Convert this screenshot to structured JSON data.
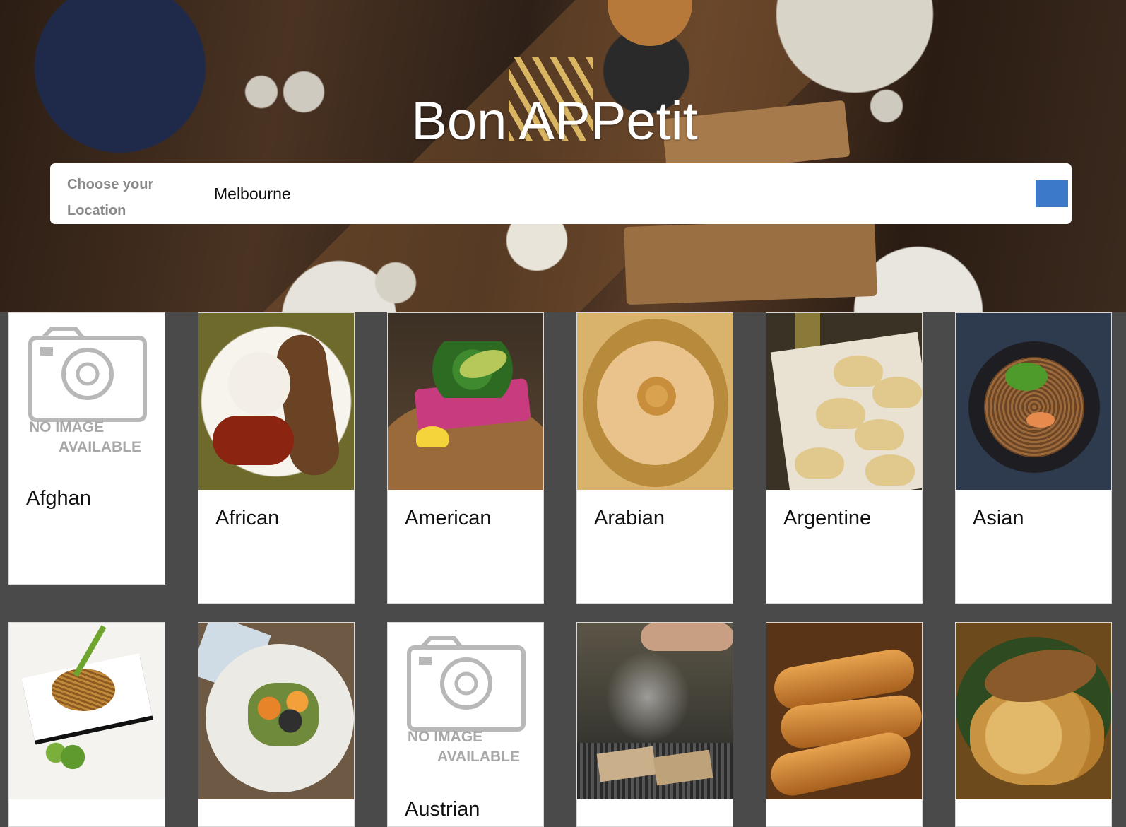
{
  "header": {
    "title": "Bon APPetit"
  },
  "search": {
    "label": "Choose your Location",
    "value": "Melbourne"
  },
  "no_image": {
    "line1": "NO IMAGE",
    "line2": "AVAILABLE"
  },
  "cuisines": [
    {
      "name": "Afghan",
      "has_image": false
    },
    {
      "name": "African",
      "has_image": true
    },
    {
      "name": "American",
      "has_image": true
    },
    {
      "name": "Arabian",
      "has_image": true
    },
    {
      "name": "Argentine",
      "has_image": true
    },
    {
      "name": "Asian",
      "has_image": true
    },
    {
      "name": "",
      "has_image": true
    },
    {
      "name": "",
      "has_image": true
    },
    {
      "name": "Austrian",
      "has_image": false
    },
    {
      "name": "",
      "has_image": true
    },
    {
      "name": "",
      "has_image": true
    },
    {
      "name": "",
      "has_image": true
    }
  ],
  "colors": {
    "page_background": "#4a4a4a",
    "search_button": "#3c7ac9",
    "label_gray": "#8a8a8a"
  }
}
